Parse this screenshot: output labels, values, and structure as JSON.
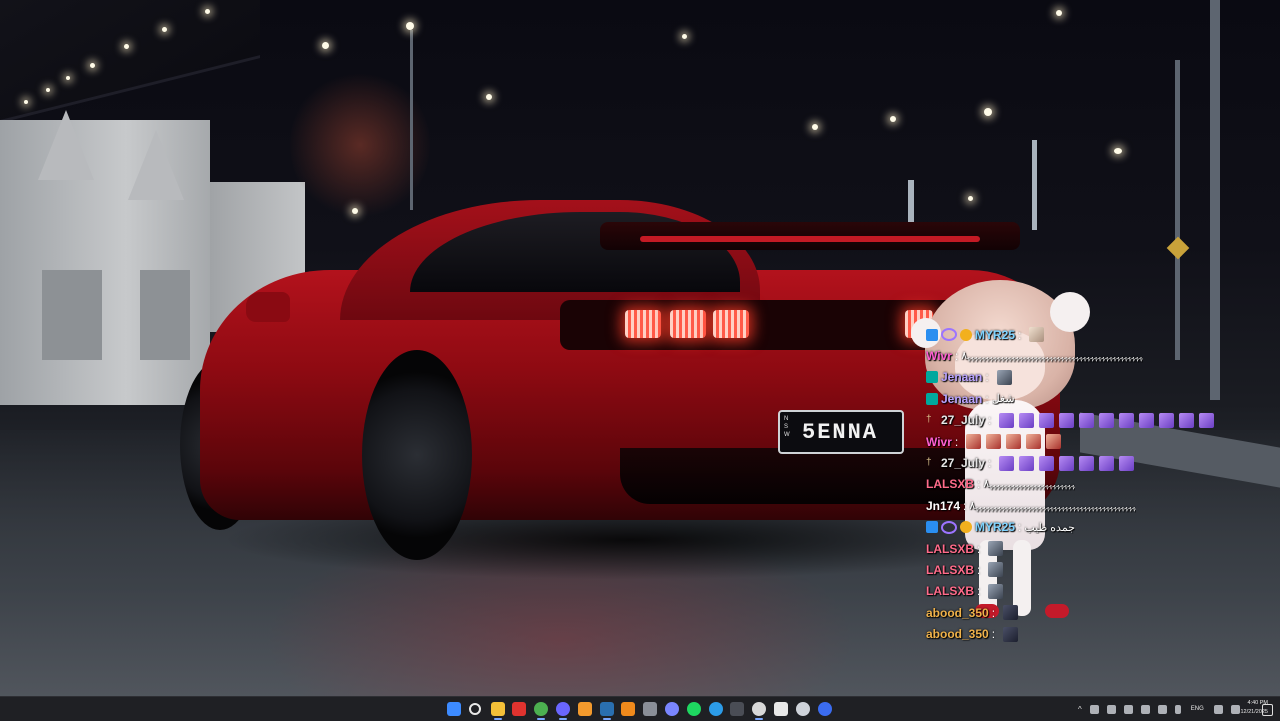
{
  "screen": {
    "type": "Windows desktop with stream chat overlay over a night-street wallpaper"
  },
  "wallpaper": {
    "car_plate_state": "N S W",
    "car_plate": "5ENNA",
    "car_color": "#b3121c"
  },
  "chat": {
    "messages": [
      {
        "user": "MYR25",
        "color": "#7fd3ff",
        "badges": [
          "blue-badge",
          "purple-ring-badge",
          "gold-badge"
        ],
        "text": "",
        "emotes": [
          "face"
        ]
      },
      {
        "user": "Wivr",
        "color": "#ff5fd2",
        "badges": [],
        "text": "ﮩﮩﮩﮩﮩﮩﮩﮩﮩﮩﮩﮩﮩﮩﮩﮩﮩﮩﮩﮩﮩﮩﮩﮩﮩﮩﮩﮩﮩﮩﮩﮩﮩﮩﮩﮩﮩﮩﮩﮩﮩﮩﮩﮩﮩﮩﮩ٨",
        "emotes": []
      },
      {
        "user": "Jenaan",
        "color": "#b9a3ff",
        "badges": [
          "teal-badge"
        ],
        "text": "",
        "emotes": [
          "dark2"
        ]
      },
      {
        "user": "Jenaan",
        "color": "#b9a3ff",
        "badges": [
          "teal-badge"
        ],
        "text": "شغل",
        "emotes": []
      },
      {
        "user": "27_July",
        "color": "#e7e7e7",
        "badges": [
          "mod-badge"
        ],
        "text": "",
        "emotes": [
          "purple",
          "purple",
          "purple",
          "purple",
          "purple",
          "purple",
          "purple",
          "purple",
          "purple",
          "purple",
          "purple"
        ]
      },
      {
        "user": "Wivr",
        "color": "#ff5fd2",
        "badges": [],
        "text": "",
        "emotes": [
          "red",
          "red",
          "red",
          "red",
          "red"
        ]
      },
      {
        "user": "27_July",
        "color": "#e7e7e7",
        "badges": [
          "mod-badge"
        ],
        "text": "",
        "emotes": [
          "purple",
          "purple",
          "purple",
          "purple",
          "purple",
          "purple",
          "purple"
        ]
      },
      {
        "user": "LALSXB",
        "color": "#ff6b8a",
        "badges": [],
        "text": "ﮩﮩﮩﮩﮩﮩﮩﮩﮩﮩﮩﮩﮩﮩﮩﮩﮩﮩﮩﮩﮩﮩﮩ٨",
        "emotes": []
      },
      {
        "user": "Jn174",
        "color": "#ffffff",
        "badges": [],
        "text": "ﮩﮩﮩﮩﮩﮩﮩﮩﮩﮩﮩﮩﮩﮩﮩﮩﮩﮩﮩﮩﮩﮩﮩﮩﮩﮩﮩﮩﮩﮩﮩﮩﮩﮩﮩﮩﮩﮩﮩﮩﮩﮩﮩ٨",
        "emotes": []
      },
      {
        "user": "MYR25",
        "color": "#7fd3ff",
        "badges": [
          "blue-badge",
          "purple-ring-badge",
          "gold-badge"
        ],
        "text": "جمده طيب",
        "emotes": []
      },
      {
        "user": "LALSXB",
        "color": "#ff6b8a",
        "badges": [],
        "text": "",
        "emotes": [
          "dark2"
        ]
      },
      {
        "user": "LALSXB",
        "color": "#ff6b8a",
        "badges": [],
        "text": "",
        "emotes": [
          "dark2"
        ]
      },
      {
        "user": "LALSXB",
        "color": "#ff6b8a",
        "badges": [],
        "text": "",
        "emotes": [
          "dark2"
        ]
      },
      {
        "user": "abood_350",
        "color": "#f0b24a",
        "badges": [],
        "text": "",
        "emotes": [
          "dark"
        ]
      },
      {
        "user": "abood_350",
        "color": "#f0b24a",
        "badges": [],
        "text": "",
        "emotes": [
          "dark"
        ]
      }
    ]
  },
  "taskbar": {
    "apps": [
      {
        "name": "start",
        "color": "#3d8bff"
      },
      {
        "name": "search",
        "color": "#e8e8e8"
      },
      {
        "name": "file-explorer",
        "color": "#f4c038"
      },
      {
        "name": "streaming-app",
        "color": "#e0332f"
      },
      {
        "name": "chrome",
        "color": "#4caf50"
      },
      {
        "name": "discord",
        "color": "#6a66ff"
      },
      {
        "name": "browser-2",
        "color": "#f39a2d"
      },
      {
        "name": "steam",
        "color": "#2a6fb0"
      },
      {
        "name": "vlc",
        "color": "#f08a1c"
      },
      {
        "name": "app-gear",
        "color": "#8a8f98"
      },
      {
        "name": "photos",
        "color": "#7a86ff"
      },
      {
        "name": "spotify",
        "color": "#1ed760"
      },
      {
        "name": "edge",
        "color": "#2c9ce8"
      },
      {
        "name": "terminal",
        "color": "#4a4d55"
      },
      {
        "name": "obs",
        "color": "#d8d8d8"
      },
      {
        "name": "app-c",
        "color": "#e8e8e8"
      },
      {
        "name": "app-wave",
        "color": "#cfd3da"
      },
      {
        "name": "app-blue",
        "color": "#3b6cf0"
      }
    ],
    "tray": {
      "language": "ENG",
      "time": "4:40 PM",
      "date": "12/21/2025"
    }
  }
}
